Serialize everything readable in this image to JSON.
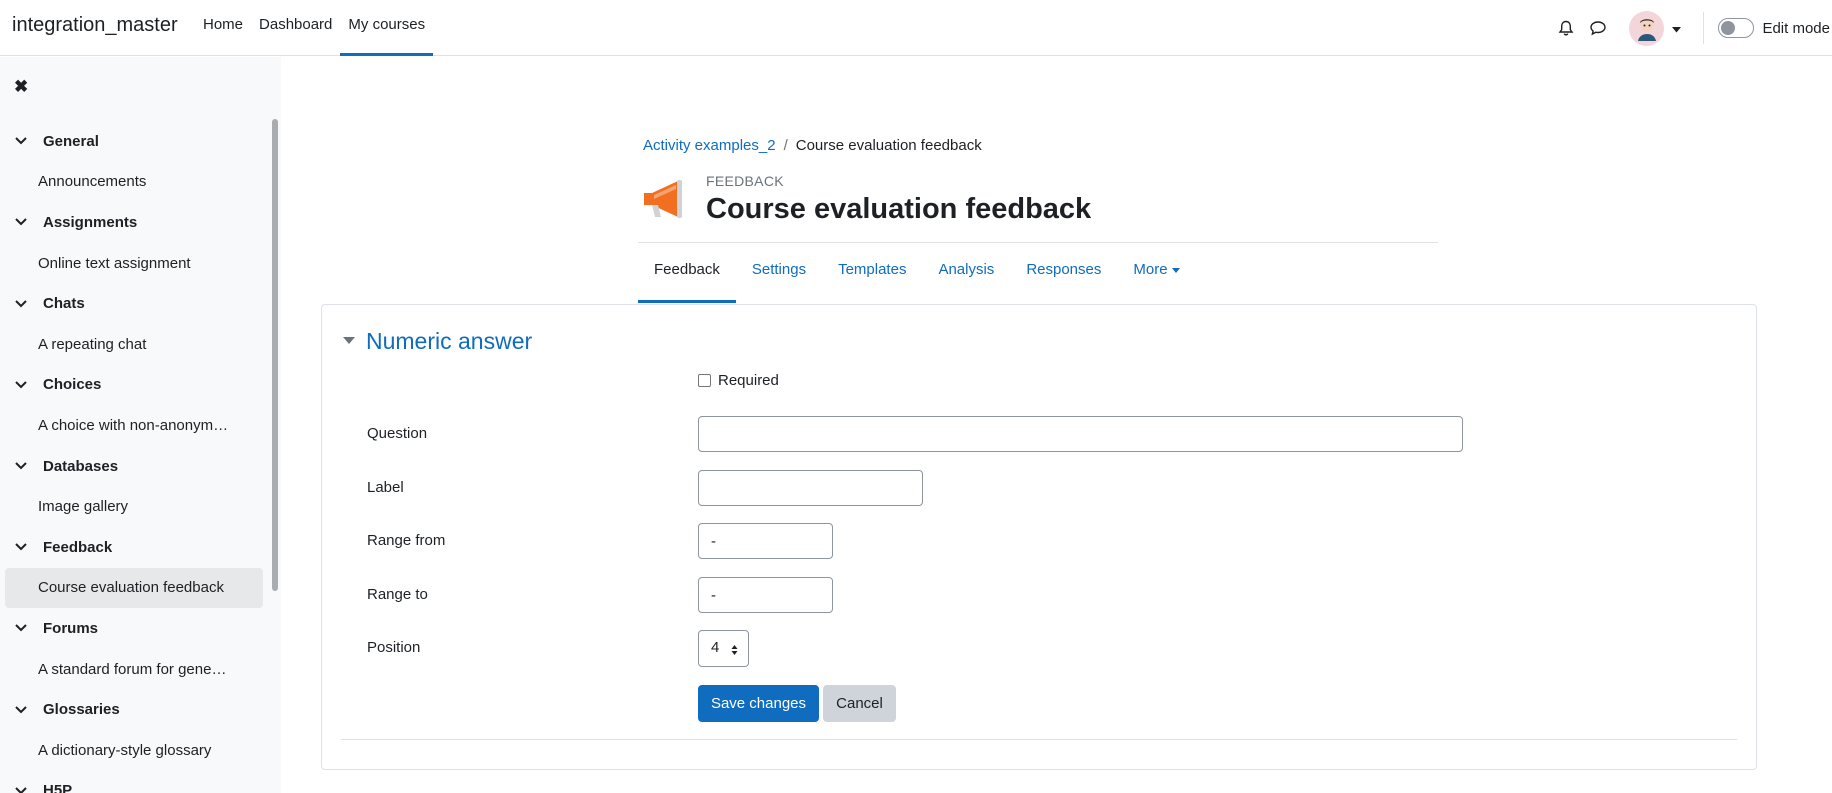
{
  "navbar": {
    "site_name": "integration_master",
    "links": [
      {
        "label": "Home",
        "active": false
      },
      {
        "label": "Dashboard",
        "active": false
      },
      {
        "label": "My courses",
        "active": true
      }
    ],
    "edit_mode_label": "Edit mode",
    "icons": [
      "bell-icon",
      "chat-icon",
      "avatar",
      "chevron-down-icon"
    ]
  },
  "drawer": {
    "close_icon": "close-icon",
    "sections": [
      {
        "title": "General",
        "items": [
          "Announcements"
        ]
      },
      {
        "title": "Assignments",
        "items": [
          "Online text assignment"
        ]
      },
      {
        "title": "Chats",
        "items": [
          "A repeating chat"
        ]
      },
      {
        "title": "Choices",
        "items": [
          "A choice with non-anonym…"
        ]
      },
      {
        "title": "Databases",
        "items": [
          "Image gallery"
        ]
      },
      {
        "title": "Feedback",
        "items": [
          "Course evaluation feedback"
        ]
      },
      {
        "title": "Forums",
        "items": [
          "A standard forum for gene…"
        ]
      },
      {
        "title": "Glossaries",
        "items": [
          "A dictionary-style glossary"
        ]
      },
      {
        "title": "H5P",
        "items": []
      }
    ],
    "active_item": "Course evaluation feedback"
  },
  "breadcrumb": {
    "parent": "Activity examples_2",
    "separator": "/",
    "current": "Course evaluation feedback"
  },
  "header": {
    "module_type": "FEEDBACK",
    "title": "Course evaluation feedback",
    "icon": "megaphone-icon"
  },
  "tabs": [
    {
      "label": "Feedback",
      "active": true
    },
    {
      "label": "Settings",
      "active": false
    },
    {
      "label": "Templates",
      "active": false
    },
    {
      "label": "Analysis",
      "active": false
    },
    {
      "label": "Responses",
      "active": false
    },
    {
      "label": "More",
      "active": false
    }
  ],
  "form": {
    "legend": "Numeric answer",
    "required_label": "Required",
    "required_checked": false,
    "question_label": "Question",
    "question_value": "",
    "label_label": "Label",
    "label_value": "",
    "range_from_label": "Range from",
    "range_from_value": "-",
    "range_to_label": "Range to",
    "range_to_value": "-",
    "position_label": "Position",
    "position_value": "4",
    "save_label": "Save changes",
    "cancel_label": "Cancel"
  },
  "colors": {
    "primary": "#0f6cbf",
    "text": "#1d2125",
    "drawer_bg": "#f8f9fa",
    "megaphone": "#f26f21"
  }
}
